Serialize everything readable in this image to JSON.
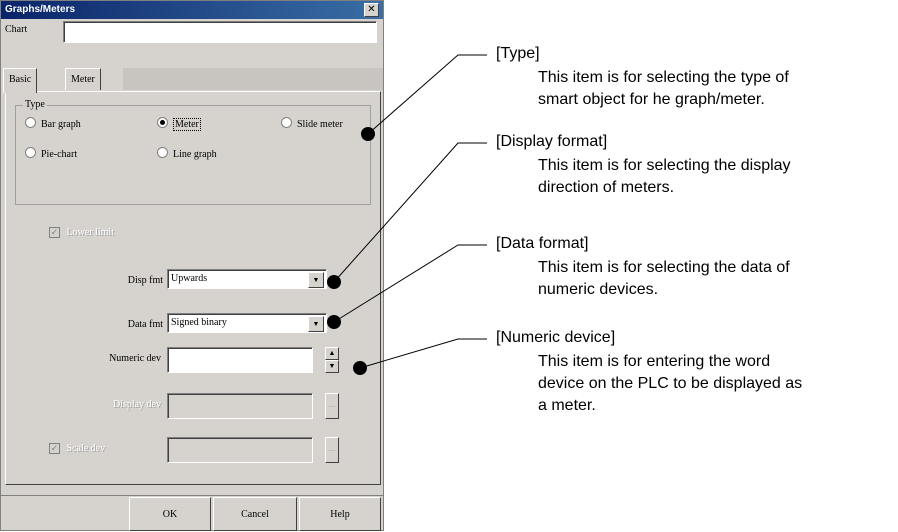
{
  "dialog": {
    "title": "Graphs/Meters",
    "close_glyph": "✕",
    "chart_label": "Chart",
    "chart_value": "",
    "tabs": [
      "Basic",
      "Meter"
    ],
    "type_group_label": "Type",
    "type_options": [
      {
        "label": "Bar graph",
        "selected": false
      },
      {
        "label": "Meter",
        "selected": true
      },
      {
        "label": "Slide meter",
        "selected": false
      },
      {
        "label": "Pie-chart",
        "selected": false
      },
      {
        "label": "Line graph",
        "selected": false
      }
    ],
    "enable_checkbox_label": "Lower limit",
    "disp_fmt_label": "Disp fmt",
    "disp_fmt_value": "Upwards",
    "data_fmt_label": "Data fmt",
    "data_fmt_value": "Signed binary",
    "numeric_dev_label": "Numeric dev",
    "numeric_dev_value": "",
    "disabled_dev_label": "Display dev",
    "scale_label": "Scale dev",
    "buttons": {
      "ok": "OK",
      "cancel": "Cancel",
      "help": "Help"
    }
  },
  "callouts": [
    {
      "title": "[Type]",
      "body": [
        "This item is for selecting the type of",
        "smart object for he graph/meter."
      ]
    },
    {
      "title": "[Display format]",
      "body": [
        "This item is for selecting the display",
        "direction of meters."
      ]
    },
    {
      "title": "[Data format]",
      "body": [
        "This item is for selecting the data of",
        "numeric devices."
      ]
    },
    {
      "title": "[Numeric device]",
      "body": [
        "This item is for entering the word",
        "device on the PLC to be displayed as",
        "a meter."
      ]
    }
  ]
}
